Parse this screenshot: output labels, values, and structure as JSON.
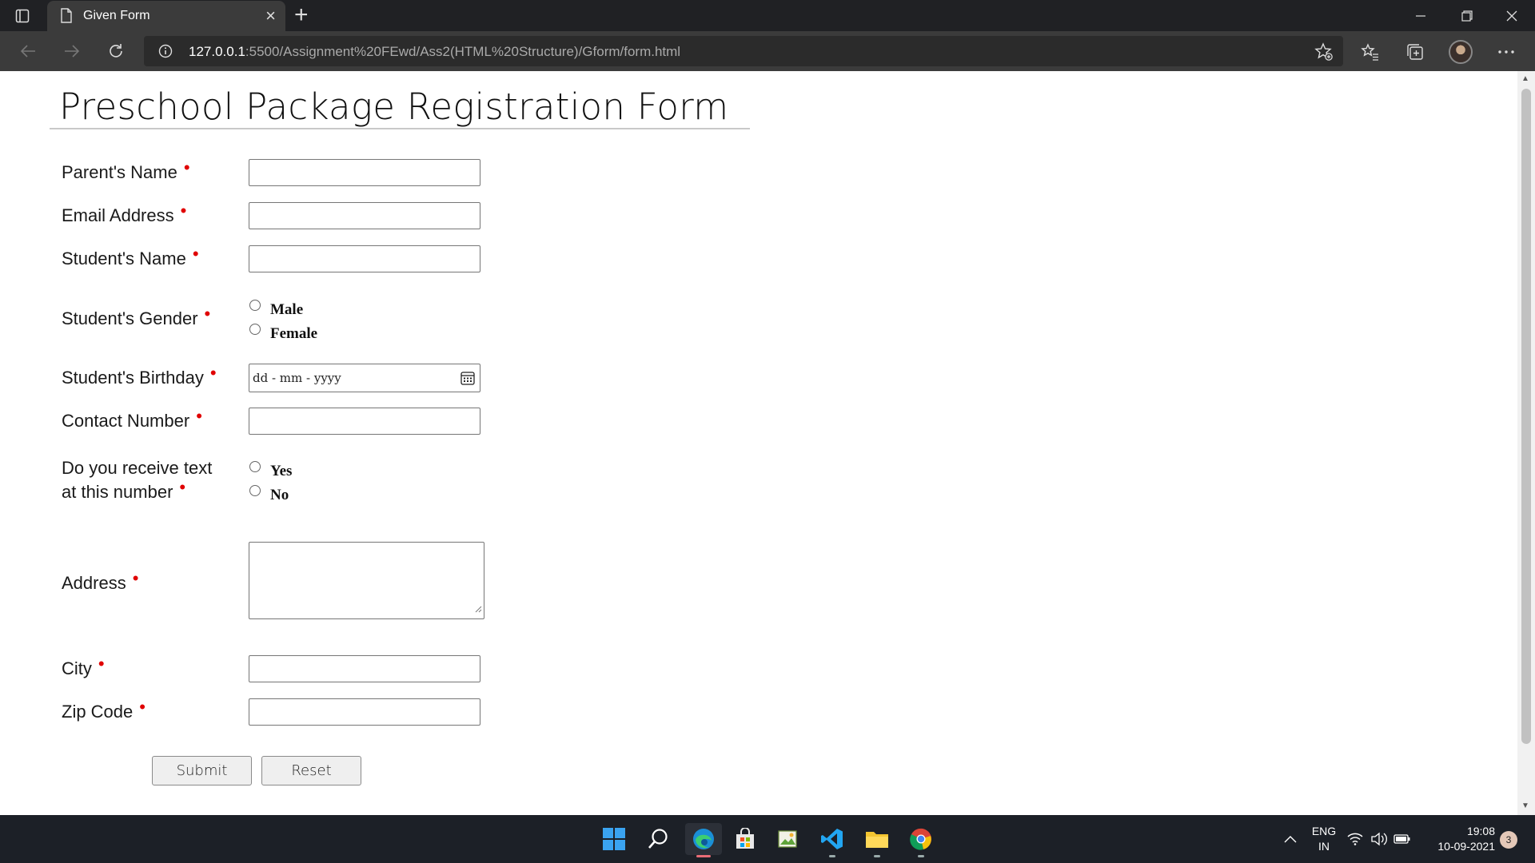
{
  "browser": {
    "tab_title": "Given Form",
    "tab_close": "×",
    "new_tab": "+",
    "url_host": "127.0.0.1",
    "url_path": ":5500/Assignment%20FEwd/Ass2(HTML%20Structure)/Gform/form.html"
  },
  "form": {
    "title": "Preschool Package Registration Form",
    "required_mark": "•",
    "labels": {
      "parent_name": "Parent's Name",
      "email": "Email Address",
      "student_name": "Student's Name",
      "gender": "Student's Gender",
      "birthday": "Student's Birthday",
      "contact": "Contact Number",
      "text_line1": "Do you receive text",
      "text_line2": "at this number",
      "address": "Address",
      "city": "City",
      "zip": "Zip Code"
    },
    "gender_options": [
      "Male",
      "Female"
    ],
    "text_options": [
      "Yes",
      "No"
    ],
    "date_placeholder": "dd - mm - yyyy",
    "submit_label": "Submit",
    "reset_label": "Reset"
  },
  "taskbar": {
    "lang_top": "ENG",
    "lang_bottom": "IN",
    "time": "19:08",
    "date": "10-09-2021",
    "notification_count": "3"
  },
  "colors": {
    "required": "#e00000",
    "titlebar": "#202124",
    "toolbar": "#3b3b3b",
    "taskbar": "#1c2027"
  }
}
